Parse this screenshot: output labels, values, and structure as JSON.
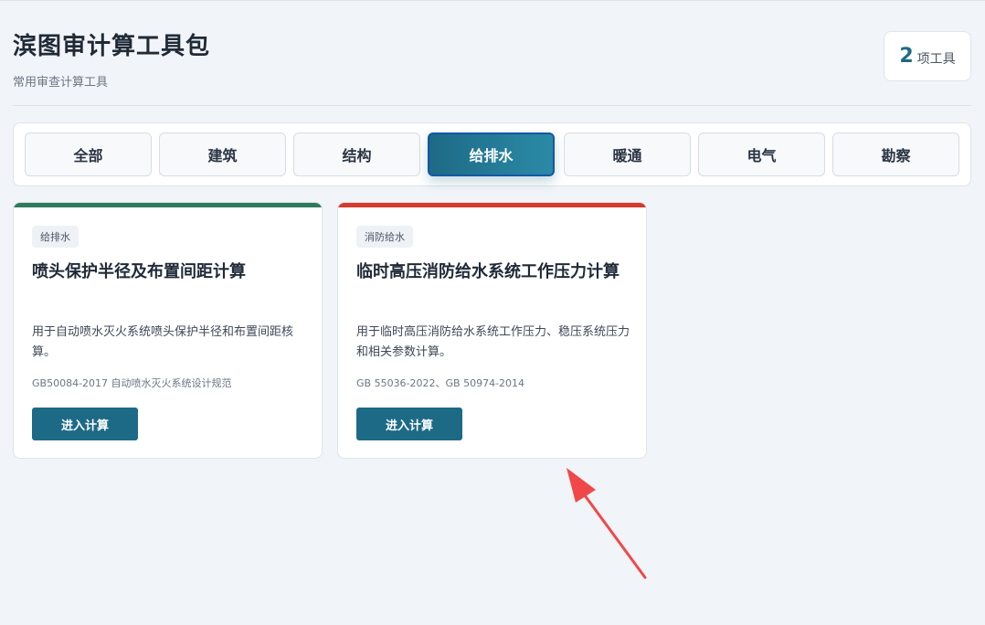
{
  "header": {
    "title": "滨图审计算工具包",
    "subtitle": "常用审查计算工具",
    "count_value": "2",
    "count_unit": "项工具"
  },
  "tabs": [
    {
      "label": "全部",
      "active": false
    },
    {
      "label": "建筑",
      "active": false
    },
    {
      "label": "结构",
      "active": false
    },
    {
      "label": "给排水",
      "active": true
    },
    {
      "label": "暖通",
      "active": false
    },
    {
      "label": "电气",
      "active": false
    },
    {
      "label": "勘察",
      "active": false
    }
  ],
  "cards": [
    {
      "tag": "给排水",
      "title": "喷头保护半径及布置间距计算",
      "description": "用于自动喷水灭火系统喷头保护半径和布置间距核算。",
      "standard": "GB50084-2017 自动喷水灭火系统设计规范",
      "button": "进入计算",
      "accent_color": "#2f7a5e"
    },
    {
      "tag": "消防给水",
      "title": "临时高压消防给水系统工作压力计算",
      "description": "用于临时高压消防给水系统工作压力、稳压系统压力和相关参数计算。",
      "standard": "GB 55036-2022、GB 50974-2014",
      "button": "进入计算",
      "accent_color": "#d63a2f"
    }
  ],
  "colors": {
    "primary": "#1d6a86",
    "background": "#f1f4f8",
    "annotation_arrow": "#f04848"
  }
}
